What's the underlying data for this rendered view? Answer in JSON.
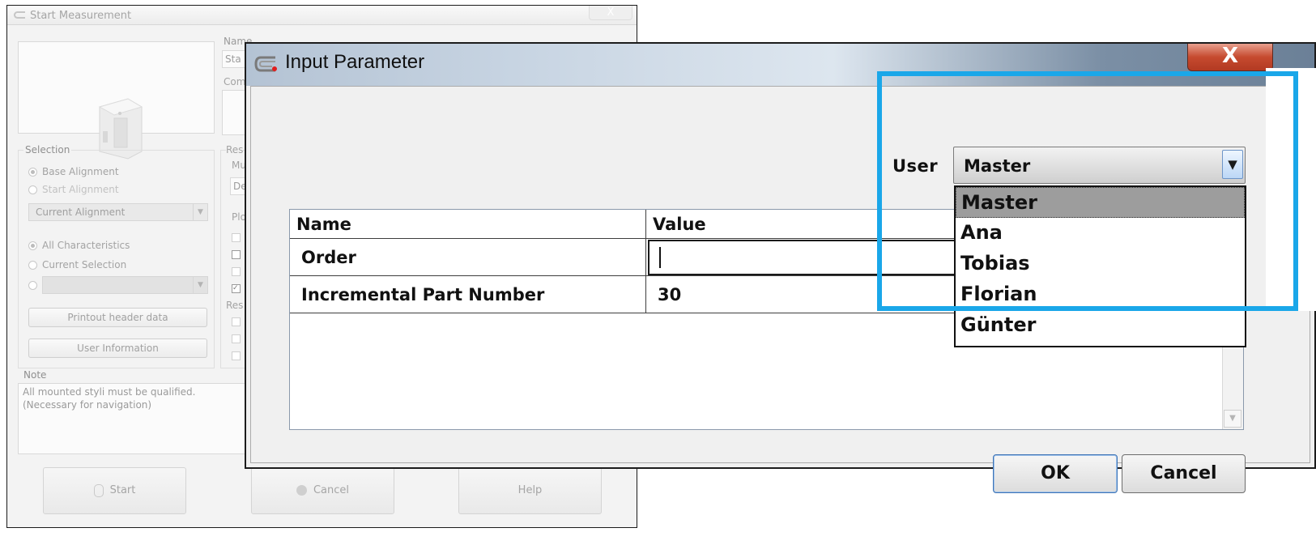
{
  "background_window": {
    "title": "Start Measurement",
    "name_label": "Name",
    "name_value": "Sta",
    "comment_label": "Com",
    "selection_label": "Selection",
    "results_label": "Res",
    "mu_label": "Mu",
    "de_value": "De",
    "plot_label": "Plo",
    "results2_label": "Res",
    "radio_base_alignment": "Base Alignment",
    "radio_start_alignment": "Start Alignment",
    "current_alignment_value": "Current Alignment",
    "radio_all_characteristics": "All Characteristics",
    "radio_current_selection": "Current Selection",
    "printout_button": "Printout header data",
    "user_info_button": "User Information",
    "note_label": "Note",
    "note_text_line1": "All mounted styli must be qualified.",
    "note_text_line2": "(Necessary for navigation)",
    "start_button": "Start",
    "cancel_button": "Cancel",
    "help_button": "Help",
    "close_glyph": "X"
  },
  "dialog": {
    "title": "Input Parameter",
    "close_glyph": "X",
    "user_label": "User",
    "user_selected": "Master",
    "user_options": [
      "Master",
      "Ana",
      "Tobias",
      "Florian",
      "Günter"
    ],
    "grid": {
      "headers": [
        "Name",
        "Value"
      ],
      "rows": [
        {
          "name": "Order",
          "value": ""
        },
        {
          "name": "Incremental Part Number",
          "value": "30"
        }
      ]
    },
    "ok_button": "OK",
    "cancel_button": "Cancel"
  },
  "colors": {
    "highlight": "#1aa7e9",
    "close_button": "#c64a2f",
    "dropdown_selected": "#9d9d9d"
  },
  "icons": {
    "app_logo": "caliper-logo-icon",
    "combo_arrow": "chevron-down-icon"
  }
}
